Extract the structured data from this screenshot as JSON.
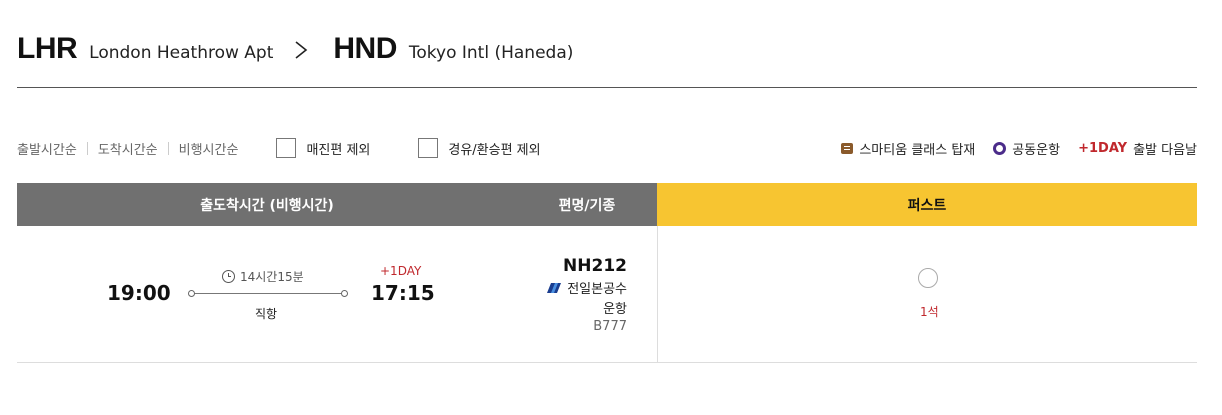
{
  "route": {
    "origin_code": "LHR",
    "origin_name": "London Heathrow Apt",
    "destination_code": "HND",
    "destination_name": "Tokyo Intl (Haneda)",
    "arrow_icon": "chevron-right-icon"
  },
  "filters": {
    "sort_options": [
      "출발시간순",
      "도착시간순",
      "비행시간순"
    ],
    "exclude_soldout_label": "매진편 제외",
    "exclude_connecting_label": "경유/환승편 제외"
  },
  "legend": {
    "smartium_label": "스마티움 클래스 탑재",
    "codeshare_label": "공동운항",
    "plusday_badge": "+1DAY",
    "plusday_label": "출발 다음날",
    "colors": {
      "smartium": "#8a5a2b",
      "codeshare": "#4b2c8a",
      "plusday": "#c0282d"
    }
  },
  "table": {
    "headers": {
      "time": "출도착시간 (비행시간)",
      "flight": "편명/기종",
      "class": "퍼스트"
    },
    "header_colors": {
      "default": "#707070",
      "class": "#f7c531"
    },
    "rows": [
      {
        "departure": "19:00",
        "duration": "14시간15분",
        "stops": "직항",
        "arrival_offset": "+1DAY",
        "arrival": "17:15",
        "flight_no": "NH212",
        "operator": "전일본공수",
        "operator_suffix": "운항",
        "aircraft": "B777",
        "seats": "1석"
      }
    ]
  }
}
